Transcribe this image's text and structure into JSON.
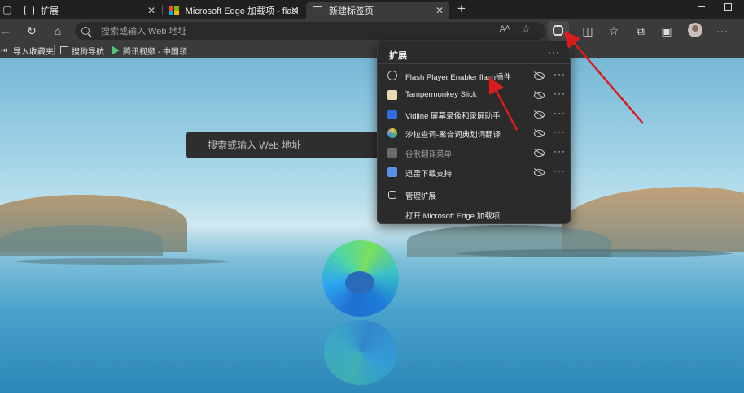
{
  "tabs": [
    {
      "title": "扩展",
      "active": false
    },
    {
      "title": "Microsoft Edge 加载项 - flash",
      "active": false
    },
    {
      "title": "新建标签页",
      "active": true
    }
  ],
  "address_bar": {
    "placeholder": "搜索或输入 Web 地址",
    "read_aloud": "Aᴬ"
  },
  "favorites": [
    {
      "label": "导入收藏夹"
    },
    {
      "label": "搜狗导航"
    },
    {
      "label": "腾讯视频 - 中国领..."
    }
  ],
  "page": {
    "search_placeholder": "搜索或输入 Web 地址"
  },
  "extensions_popup": {
    "title": "扩展",
    "items": [
      {
        "label": "Flash Player Enabler flash插件",
        "icon": "flash-disabled-icon",
        "dim": false
      },
      {
        "label": "Tampermonkey Slick",
        "icon": "tampermonkey-icon",
        "dim": false
      },
      {
        "label": "Vidline 屏幕录像和录屏助手",
        "icon": "vidline-icon",
        "dim": false
      },
      {
        "label": "沙拉查词-聚合词典划词翻译",
        "icon": "saladict-icon",
        "dim": false
      },
      {
        "label": "谷歌翻译菜单",
        "icon": "google-translate-icon",
        "dim": true
      },
      {
        "label": "迅雷下载支持",
        "icon": "thunder-icon",
        "dim": false
      }
    ],
    "actions": [
      {
        "label": "管理扩展"
      },
      {
        "label": "打开 Microsoft Edge 加载项"
      }
    ]
  },
  "colors": {
    "annotation_arrow": "#d91c1c",
    "edge_blue": "#1e6fd0",
    "edge_green": "#4fd6a4"
  }
}
